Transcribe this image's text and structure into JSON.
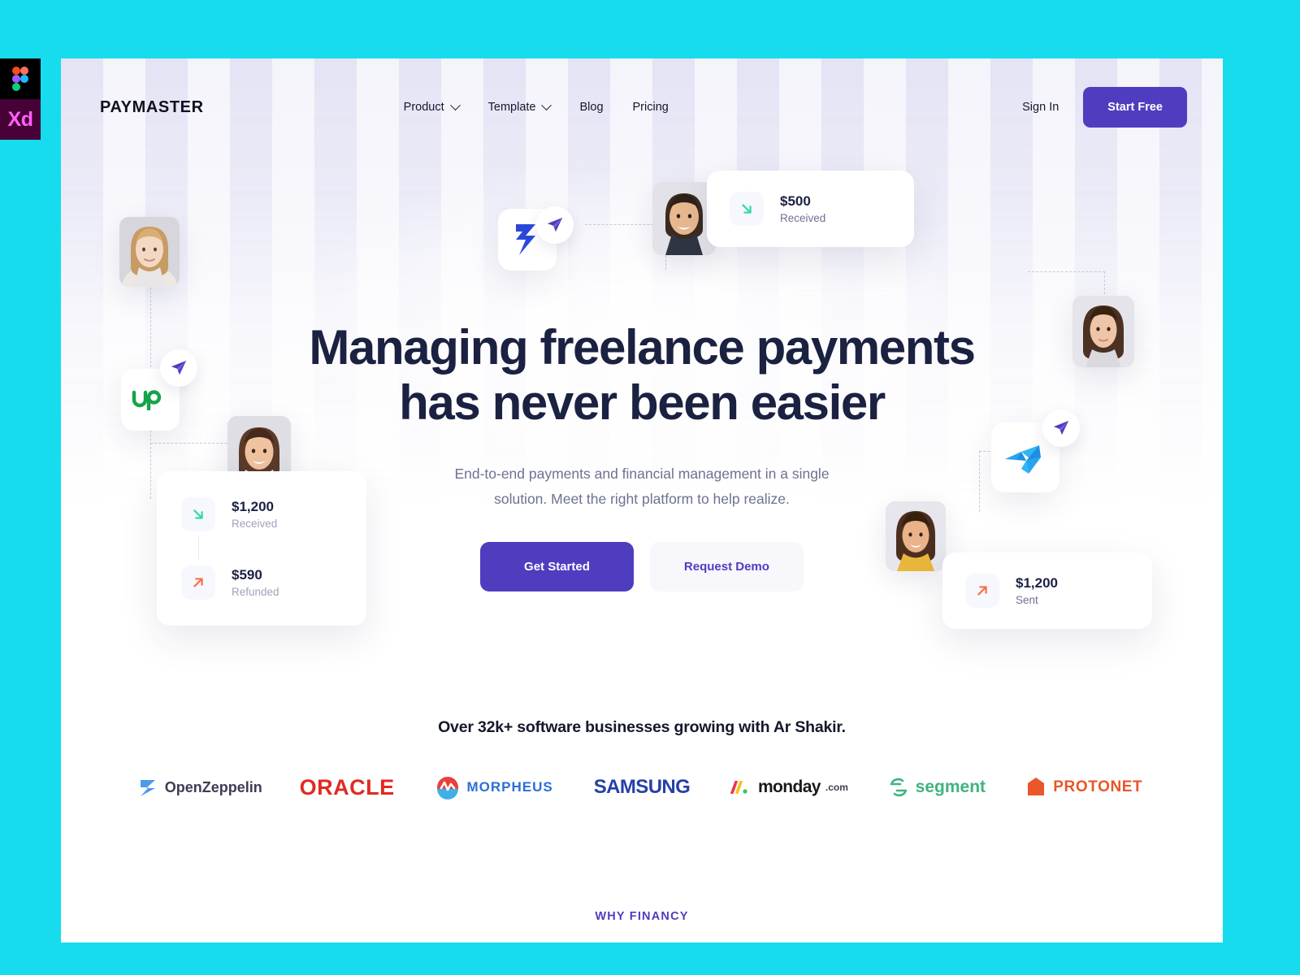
{
  "tools": {
    "figma_label": "Figma",
    "xd_label": "Xd"
  },
  "header": {
    "logo": "PAYMASTER",
    "nav": [
      {
        "label": "Product",
        "has_dropdown": true
      },
      {
        "label": "Template",
        "has_dropdown": true
      },
      {
        "label": "Blog",
        "has_dropdown": false
      },
      {
        "label": "Pricing",
        "has_dropdown": false
      }
    ],
    "signin_label": "Sign In",
    "cta_label": "Start Free",
    "cta_color": "#4F3DC0"
  },
  "hero": {
    "title_line1": "Managing freelance payments",
    "title_line2": "has never been easier",
    "subtitle": "End-to-end payments and financial management in a single solution. Meet the right platform to help realize.",
    "primary_cta": "Get Started",
    "secondary_cta": "Request Demo",
    "title_color": "#1B2141",
    "subtitle_color": "#6E7191"
  },
  "floating": {
    "cards": [
      {
        "id": "card-top",
        "rows": [
          {
            "amount": "$500",
            "label": "Received",
            "direction": "down-right",
            "color": "#2FD9A6"
          }
        ]
      },
      {
        "id": "card-left",
        "rows": [
          {
            "amount": "$1,200",
            "label": "Received",
            "direction": "down-right",
            "color": "#2FD9A6"
          },
          {
            "amount": "$590",
            "label": "Refunded",
            "direction": "up-right",
            "color": "#F96F4B"
          }
        ]
      },
      {
        "id": "card-right",
        "rows": [
          {
            "amount": "$1,200",
            "label": "Sent",
            "direction": "up-right",
            "color": "#F96F4B"
          }
        ]
      }
    ],
    "platforms": [
      {
        "name": "freelancer-logo",
        "color": "#2A49D8"
      },
      {
        "name": "upwork-logo",
        "color": "#16A34A"
      },
      {
        "name": "toptal-logo",
        "color": "#20A4F3"
      }
    ],
    "avatars": [
      {
        "name": "avatar-blonde-woman"
      },
      {
        "name": "avatar-smiling-man"
      },
      {
        "name": "avatar-brunette-woman-left"
      },
      {
        "name": "avatar-brunette-woman-right"
      },
      {
        "name": "avatar-woman-yellow-top"
      }
    ],
    "plane_badge_color": "#4F3DC0"
  },
  "proof": {
    "title": "Over 32k+ software businesses growing with Ar Shakir.",
    "logos": [
      {
        "name": "openzeppelin-logo",
        "text": "OpenZeppelin",
        "color": "#3D3D55"
      },
      {
        "name": "oracle-logo",
        "text": "ORACLE",
        "color": "#E02A23"
      },
      {
        "name": "morpheus-logo",
        "text": "MORPHEUS",
        "color": "#2B6FD6"
      },
      {
        "name": "samsung-logo",
        "text": "SAMSUNG",
        "color": "#2540A8"
      },
      {
        "name": "monday-logo",
        "text": "monday",
        "suffix": ".com",
        "color": "#1A1A1A"
      },
      {
        "name": "segment-logo",
        "text": "segment",
        "color": "#3FB37F"
      },
      {
        "name": "protonet-logo",
        "text": "PROTONET",
        "color": "#E8562A"
      }
    ]
  },
  "footer_teaser": {
    "label": "WHY FINANCY",
    "color": "#4F3DC0"
  }
}
